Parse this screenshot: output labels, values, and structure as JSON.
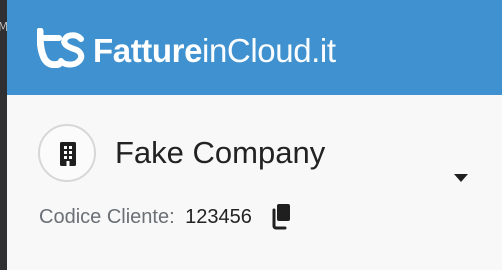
{
  "header": {
    "brand_strong": "Fatture",
    "brand_light": "inCloud.it"
  },
  "company": {
    "name": "Fake Company",
    "avatar_icon": "building-icon",
    "dropdown_icon": "caret-down-icon"
  },
  "client": {
    "label": "Codice Cliente:",
    "value": "123456",
    "copy_icon": "copy-icon"
  },
  "colors": {
    "header_bg": "#3f92cf",
    "panel_bg": "#f8f8f8",
    "text_primary": "#222222",
    "text_secondary": "#6b6f76"
  }
}
